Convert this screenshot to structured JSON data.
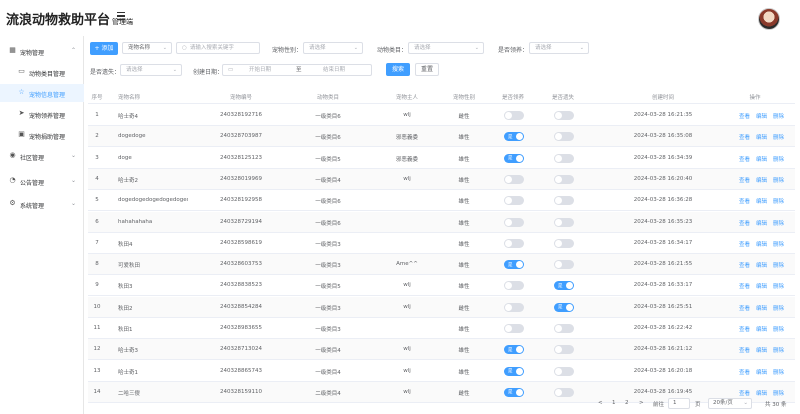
{
  "header": {
    "title": "流浪动物救助平台",
    "subtitle": "管理端"
  },
  "sidebar": [
    {
      "label": "宠物管理",
      "icon": "grid-icon",
      "chev": "^",
      "level": "top"
    },
    {
      "label": "动物类目管理",
      "icon": "folder-icon",
      "level": "sub"
    },
    {
      "label": "宠物信息管理",
      "icon": "star-icon",
      "level": "sub",
      "active": true
    },
    {
      "label": "宠物领养管理",
      "icon": "send-icon",
      "level": "sub"
    },
    {
      "label": "宠物捐助管理",
      "icon": "box-icon",
      "level": "sub"
    },
    {
      "label": "社区管理",
      "icon": "location-icon",
      "chev": "v",
      "level": "top"
    },
    {
      "label": "公告管理",
      "icon": "bell-icon",
      "chev": "v",
      "level": "top"
    },
    {
      "label": "系统管理",
      "icon": "gear-icon",
      "chev": "v",
      "level": "top"
    }
  ],
  "toolbar": {
    "add_label": "+ 添加",
    "search_field": "宠物名称",
    "search_placeholder": "请输入搜索关键字",
    "gender_label": "宠物性别：",
    "category_label": "动物类目：",
    "adopted_label": "是否领养：",
    "lost_label": "是否遗失：",
    "date_label": "创建日期：",
    "select_placeholder": "请选择",
    "start_date": "开始日期",
    "date_sep": "至",
    "end_date": "结束日期",
    "search_btn": "搜索",
    "reset_btn": "重置"
  },
  "table": {
    "headers": [
      "序号",
      "宠物名称",
      "宠物编号",
      "动物类目",
      "宠物主人",
      "宠物性别",
      "是否领养",
      "是否遗失",
      "创建时间",
      "操作"
    ],
    "switch_on": "是",
    "switch_off": "否",
    "actions": [
      "查看",
      "编辑",
      "删除"
    ],
    "rows": [
      {
        "no": "1",
        "name": "哈士奇4",
        "code": "240328192716",
        "category": "一级类目6",
        "owner": "wlj",
        "gender": "雌性",
        "adopted": false,
        "lost": false,
        "time": "2024-03-28 16:21:35"
      },
      {
        "no": "2",
        "name": "dogedoge",
        "code": "240328703987",
        "category": "一级类目6",
        "owner": "邪恶義委",
        "gender": "雄性",
        "adopted": true,
        "lost": false,
        "time": "2024-03-28 16:35:08"
      },
      {
        "no": "3",
        "name": "doge",
        "code": "240328125123",
        "category": "一级类目5",
        "owner": "邪恶義委",
        "gender": "雄性",
        "adopted": true,
        "lost": false,
        "time": "2024-03-28 16:34:39"
      },
      {
        "no": "4",
        "name": "哈士奇2",
        "code": "240328019969",
        "category": "一级类目4",
        "owner": "wlj",
        "gender": "雄性",
        "adopted": false,
        "lost": false,
        "time": "2024-03-28 16:20:40"
      },
      {
        "no": "5",
        "name": "dogedogedogedogedoged...",
        "code": "240328192958",
        "category": "一级类目6",
        "owner": "",
        "gender": "雄性",
        "adopted": false,
        "lost": false,
        "time": "2024-03-28 16:36:28"
      },
      {
        "no": "6",
        "name": "hahahahaha",
        "code": "240328729194",
        "category": "一级类目6",
        "owner": "",
        "gender": "雄性",
        "adopted": false,
        "lost": false,
        "time": "2024-03-28 16:35:23"
      },
      {
        "no": "7",
        "name": "秋田4",
        "code": "240328598619",
        "category": "一级类目3",
        "owner": "",
        "gender": "雄性",
        "adopted": false,
        "lost": false,
        "time": "2024-03-28 16:34:17"
      },
      {
        "no": "8",
        "name": "可爱秋田",
        "code": "240328603753",
        "category": "一级类目3",
        "owner": "Ame^^",
        "gender": "雄性",
        "adopted": true,
        "lost": false,
        "time": "2024-03-28 16:21:55"
      },
      {
        "no": "9",
        "name": "秋田3",
        "code": "240328838523",
        "category": "一级类目5",
        "owner": "wlj",
        "gender": "雄性",
        "adopted": false,
        "lost": true,
        "time": "2024-03-28 16:33:17"
      },
      {
        "no": "10",
        "name": "秋田2",
        "code": "240328854284",
        "category": "一级类目3",
        "owner": "wlj",
        "gender": "雌性",
        "adopted": false,
        "lost": true,
        "time": "2024-03-28 16:25:51"
      },
      {
        "no": "11",
        "name": "秋田1",
        "code": "240328983655",
        "category": "一级类目3",
        "owner": "",
        "gender": "雄性",
        "adopted": false,
        "lost": false,
        "time": "2024-03-28 16:22:42"
      },
      {
        "no": "12",
        "name": "哈士奇3",
        "code": "240328713024",
        "category": "一级类目4",
        "owner": "wlj",
        "gender": "雄性",
        "adopted": true,
        "lost": false,
        "time": "2024-03-28 16:21:12"
      },
      {
        "no": "13",
        "name": "哈士奇1",
        "code": "240328865743",
        "category": "一级类目4",
        "owner": "wlj",
        "gender": "雄性",
        "adopted": true,
        "lost": false,
        "time": "2024-03-28 16:20:18"
      },
      {
        "no": "14",
        "name": "二哈三傻",
        "code": "240328159110",
        "category": "二级类目4",
        "owner": "wlj",
        "gender": "雌性",
        "adopted": true,
        "lost": false,
        "time": "2024-03-28 16:19:45"
      }
    ]
  },
  "pagination": {
    "prev": "<",
    "pages": [
      "1",
      "2"
    ],
    "next": ">",
    "goto_label": "前往",
    "goto_value": "1",
    "page_unit": "页",
    "page_size": "20条/页",
    "total": "共 30 条"
  },
  "colors": {
    "primary": "#409eff",
    "sidebar_active_bg": "#ecf5ff"
  }
}
